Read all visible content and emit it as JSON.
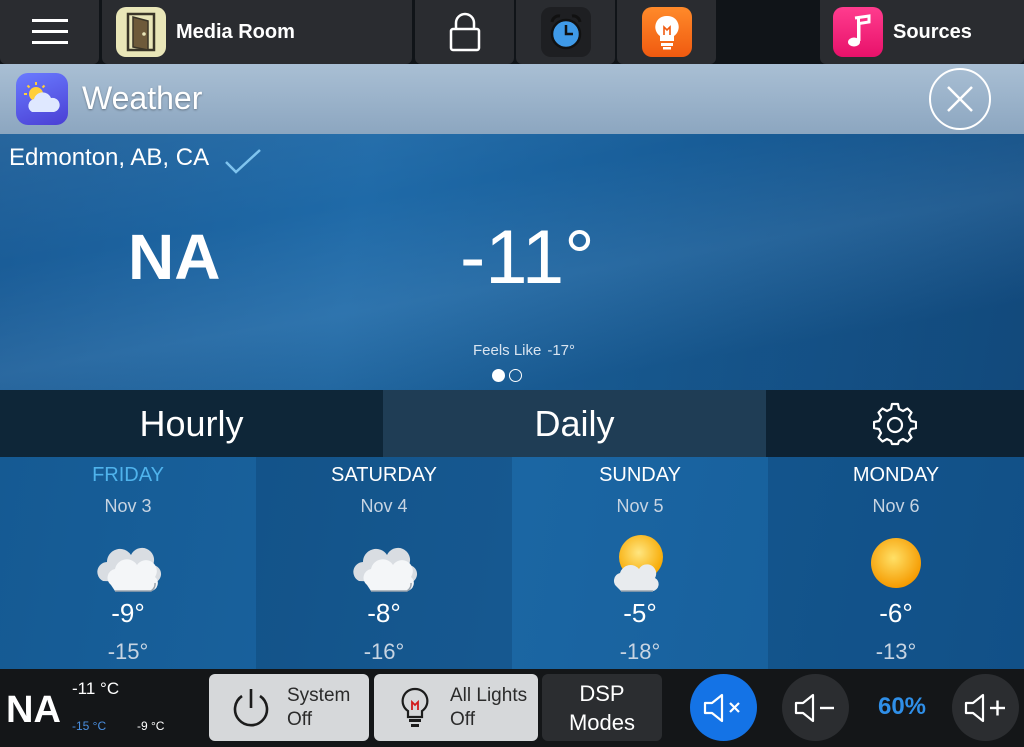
{
  "topbar": {
    "room_label": "Media Room",
    "sources_label": "Sources"
  },
  "header": {
    "title": "Weather"
  },
  "current": {
    "location": "Edmonton, AB, CA",
    "condition": "NA",
    "temperature": "-11°",
    "feels_like_label": "Feels Like",
    "feels_like_value": "-17°"
  },
  "tabs": {
    "hourly": "Hourly",
    "daily": "Daily"
  },
  "forecast": [
    {
      "day": "FRIDAY",
      "date": "Nov 3",
      "high": "-9°",
      "low": "-15°",
      "icon": "cloudy-icon"
    },
    {
      "day": "SATURDAY",
      "date": "Nov 4",
      "high": "-8°",
      "low": "-16°",
      "icon": "cloudy-icon"
    },
    {
      "day": "SUNDAY",
      "date": "Nov 5",
      "high": "-5°",
      "low": "-18°",
      "icon": "partly-cloudy-icon"
    },
    {
      "day": "MONDAY",
      "date": "Nov 6",
      "high": "-6°",
      "low": "-13°",
      "icon": "sunny-icon"
    }
  ],
  "bottombar": {
    "condition": "NA",
    "temperature": "-11 °C",
    "low": "-15 °C",
    "high": "-9 °C",
    "system_line1": "System",
    "system_line2": "Off",
    "lights_line1": "All Lights",
    "lights_line2": "Off",
    "dsp_line1": "DSP",
    "dsp_line2": "Modes",
    "volume": "60%"
  },
  "colors": {
    "accent": "#2f8fe8",
    "today": "#4fb3ec",
    "mute_active": "#1473e6"
  }
}
